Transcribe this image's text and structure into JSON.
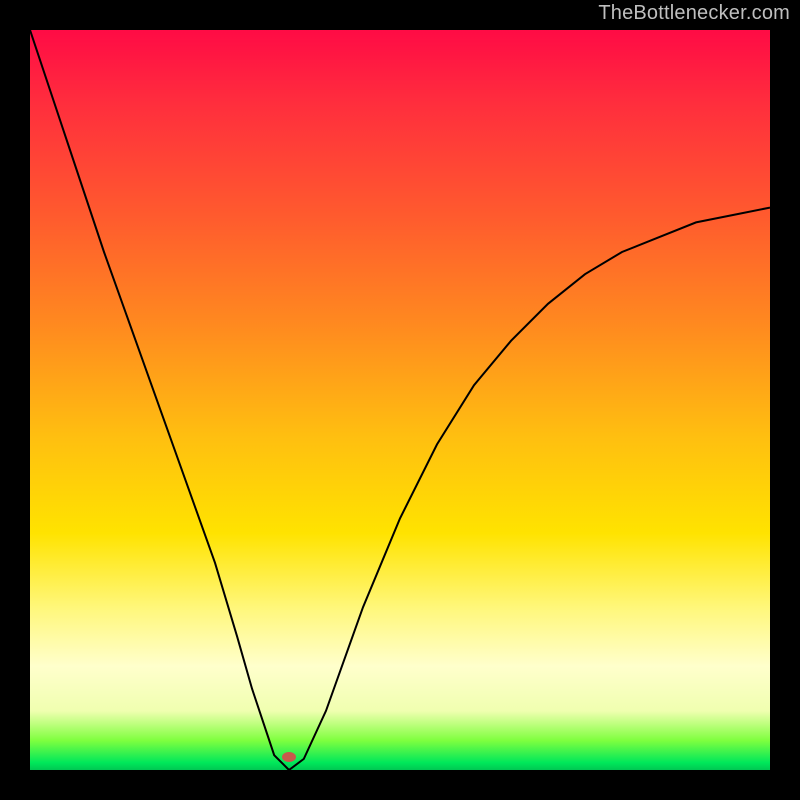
{
  "watermark": "TheBottlenecker.com",
  "curve_color": "#000000",
  "dot": {
    "x_pct": 35.0,
    "y_pct": 98.2,
    "color": "#c7594b"
  },
  "chart_data": {
    "type": "line",
    "title": "",
    "xlabel": "",
    "ylabel": "",
    "xlim": [
      0,
      100
    ],
    "ylim": [
      0,
      100
    ],
    "series": [
      {
        "name": "bottleneck-curve",
        "x": [
          0,
          5,
          10,
          15,
          20,
          25,
          28,
          30,
          32,
          33,
          34,
          35,
          37,
          40,
          45,
          50,
          55,
          60,
          65,
          70,
          75,
          80,
          85,
          90,
          95,
          100
        ],
        "values": [
          100,
          85,
          70,
          56,
          42,
          28,
          18,
          11,
          5,
          2,
          1,
          0,
          1.5,
          8,
          22,
          34,
          44,
          52,
          58,
          63,
          67,
          70,
          72,
          74,
          75,
          76
        ]
      }
    ],
    "annotations": [
      {
        "name": "min-point",
        "x": 35,
        "y": 0
      }
    ]
  }
}
